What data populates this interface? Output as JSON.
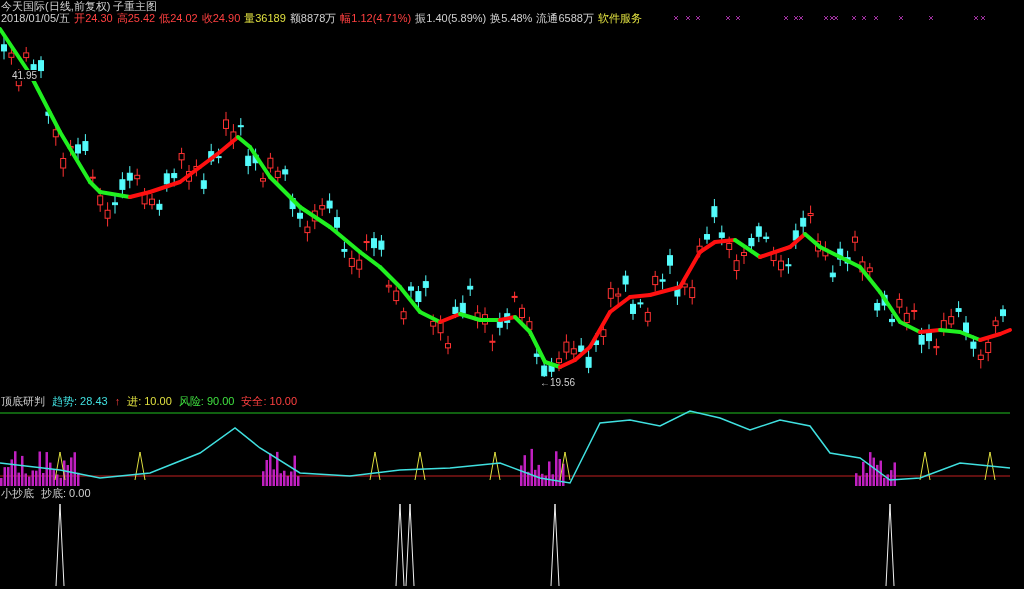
{
  "title": "今天国际(日线,前复权) 子重主图",
  "quote": [
    {
      "text": "2018/01/05/五",
      "kind": "plain"
    },
    {
      "text": "开24.30",
      "kind": "up"
    },
    {
      "text": "高25.42",
      "kind": "up"
    },
    {
      "text": "低24.02",
      "kind": "up"
    },
    {
      "text": "收24.90",
      "kind": "up"
    },
    {
      "text": "量36189",
      "kind": "volume"
    },
    {
      "text": "额8878万",
      "kind": "plain"
    },
    {
      "text": "幅1.12(4.71%)",
      "kind": "up"
    },
    {
      "text": "振1.40(5.89%)",
      "kind": "plain"
    },
    {
      "text": "换5.48%",
      "kind": "plain"
    },
    {
      "text": "流通6588万",
      "kind": "plain"
    },
    {
      "text": "软件服务",
      "kind": "volume"
    }
  ],
  "main_chart": {
    "price_labels": [
      {
        "text": "41.95"
      },
      {
        "text": "←19.56"
      }
    ]
  },
  "indicator": {
    "name": "顶底研判",
    "values": [
      {
        "text": "趋势: 28.43",
        "kind": "trend"
      },
      {
        "text": "↑",
        "kind": "up"
      },
      {
        "text": "进: 10.00",
        "kind": "volume"
      },
      {
        "text": "风险: 90.00",
        "kind": "risk"
      },
      {
        "text": "安全: 10.00",
        "kind": "up"
      }
    ]
  },
  "lower_indicator": {
    "name": "小抄底",
    "values": [
      {
        "text": "抄底: 0.00"
      }
    ]
  }
}
